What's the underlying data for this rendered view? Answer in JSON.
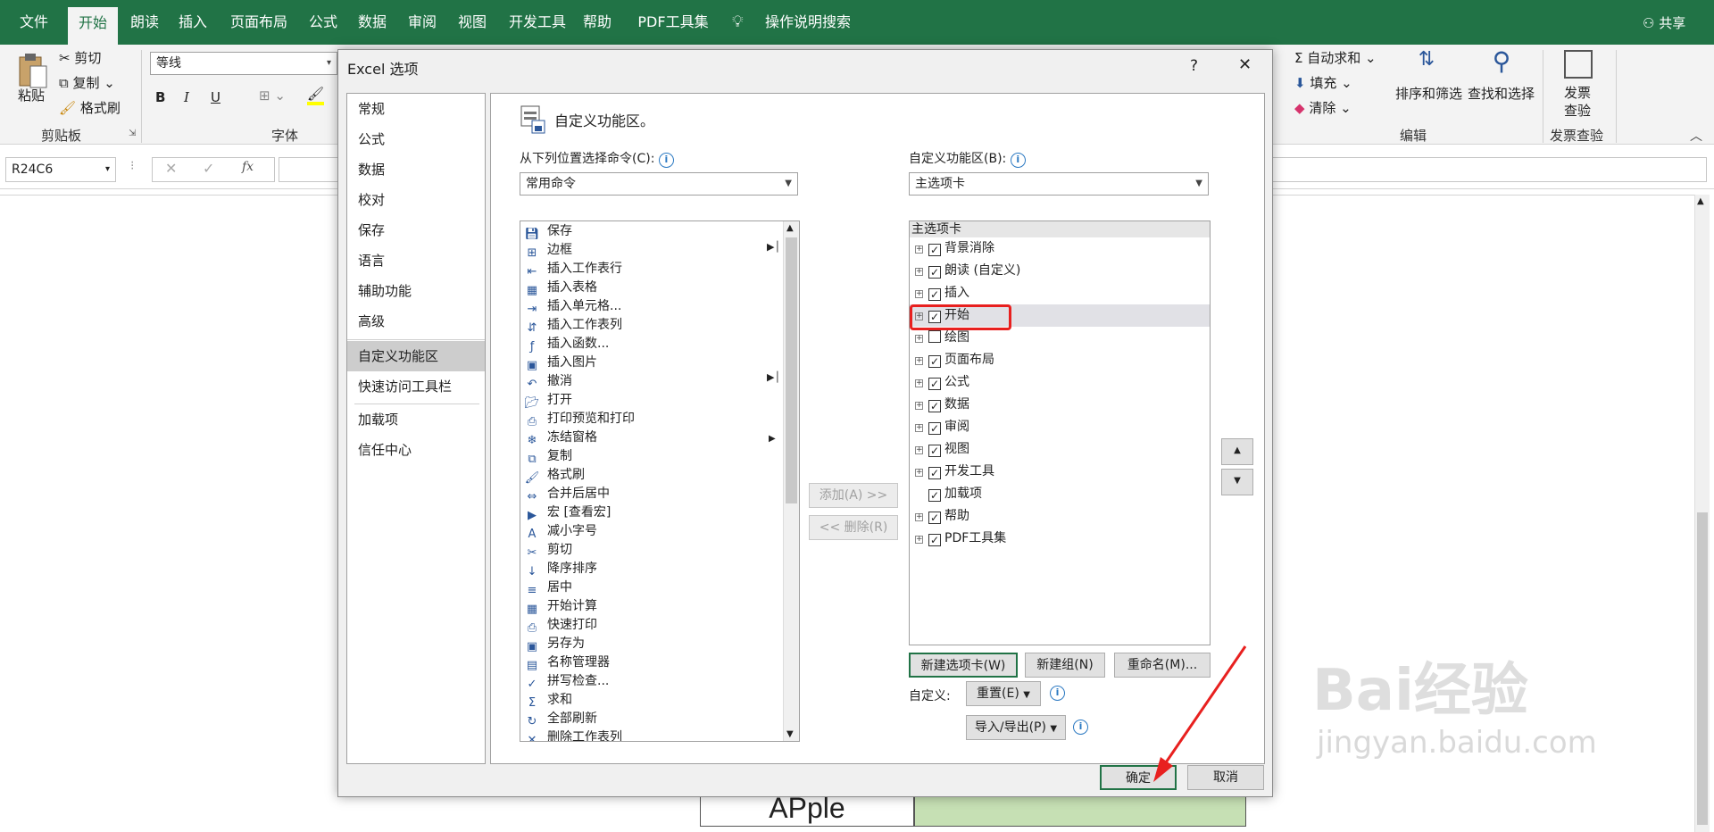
{
  "ribbon_tabs": [
    "文件",
    "开始",
    "朗读",
    "插入",
    "页面布局",
    "公式",
    "数据",
    "审阅",
    "视图",
    "开发工具",
    "帮助",
    "PDF工具集"
  ],
  "tell_me": "操作说明搜索",
  "share": "共享",
  "clipboard": {
    "paste": "粘贴",
    "cut": "剪切",
    "copy": "复制",
    "format_painter": "格式刷",
    "label": "剪贴板"
  },
  "font": {
    "name": "等线",
    "bold": "B",
    "italic": "I",
    "underline": "U",
    "label": "字体"
  },
  "editing": {
    "autosum": "自动求和",
    "fill": "填充",
    "clear": "清除",
    "sort": "排序和筛选",
    "find": "查找和选择",
    "label": "编辑"
  },
  "invoice": {
    "title_line1": "发票",
    "title_line2": "查验",
    "label": "发票查验"
  },
  "name_box": "R24C6",
  "cell_text": "APple",
  "dialog": {
    "title": "Excel 选项",
    "help": "?",
    "close": "✕",
    "nav": [
      "常规",
      "公式",
      "数据",
      "校对",
      "保存",
      "语言",
      "辅助功能",
      "高级",
      "自定义功能区",
      "快速访问工具栏",
      "加载项",
      "信任中心"
    ],
    "nav_selected": "自定义功能区",
    "header": "自定义功能区。",
    "choose_from_label": "从下列位置选择命令(C):",
    "choose_from_value": "常用命令",
    "customize_label": "自定义功能区(B):",
    "customize_value": "主选项卡",
    "commands": [
      "保存",
      "边框",
      "插入工作表行",
      "插入表格",
      "插入单元格...",
      "插入工作表列",
      "插入函数...",
      "插入图片",
      "撤消",
      "打开",
      "打印预览和打印",
      "冻结窗格",
      "复制",
      "格式刷",
      "合并后居中",
      "宏 [查看宏]",
      "减小字号",
      "剪切",
      "降序排序",
      "居中",
      "开始计算",
      "快速打印",
      "另存为",
      "名称管理器",
      "拼写检查...",
      "求和",
      "全部刷新",
      "删除工作表列"
    ],
    "tree_header": "主选项卡",
    "tree": [
      {
        "label": "背景消除",
        "checked": true,
        "expand": true
      },
      {
        "label": "朗读 (自定义)",
        "checked": true,
        "expand": true
      },
      {
        "label": "插入",
        "checked": true,
        "expand": true
      },
      {
        "label": "开始",
        "checked": true,
        "expand": true
      },
      {
        "label": "绘图",
        "checked": false,
        "expand": true
      },
      {
        "label": "页面布局",
        "checked": true,
        "expand": true
      },
      {
        "label": "公式",
        "checked": true,
        "expand": true
      },
      {
        "label": "数据",
        "checked": true,
        "expand": true
      },
      {
        "label": "审阅",
        "checked": true,
        "expand": true
      },
      {
        "label": "视图",
        "checked": true,
        "expand": true
      },
      {
        "label": "开发工具",
        "checked": true,
        "expand": true
      },
      {
        "label": "加载项",
        "checked": true,
        "expand": false
      },
      {
        "label": "帮助",
        "checked": true,
        "expand": true
      },
      {
        "label": "PDF工具集",
        "checked": true,
        "expand": true
      }
    ],
    "add_button": "添加(A) >>",
    "remove_button": "<< 删除(R)",
    "new_tab": "新建选项卡(W)",
    "new_group": "新建组(N)",
    "rename": "重命名(M)...",
    "customizations_label": "自定义:",
    "reset": "重置(E)",
    "import_export": "导入/导出(P)",
    "ok": "确定",
    "cancel": "取消"
  },
  "watermark": {
    "brand": "Bai经验",
    "url": "jingyan.baidu.com"
  },
  "colors": {
    "excel_green": "#217346",
    "highlight_red": "#e8201f",
    "cell_fill": "#c6e0b4"
  }
}
